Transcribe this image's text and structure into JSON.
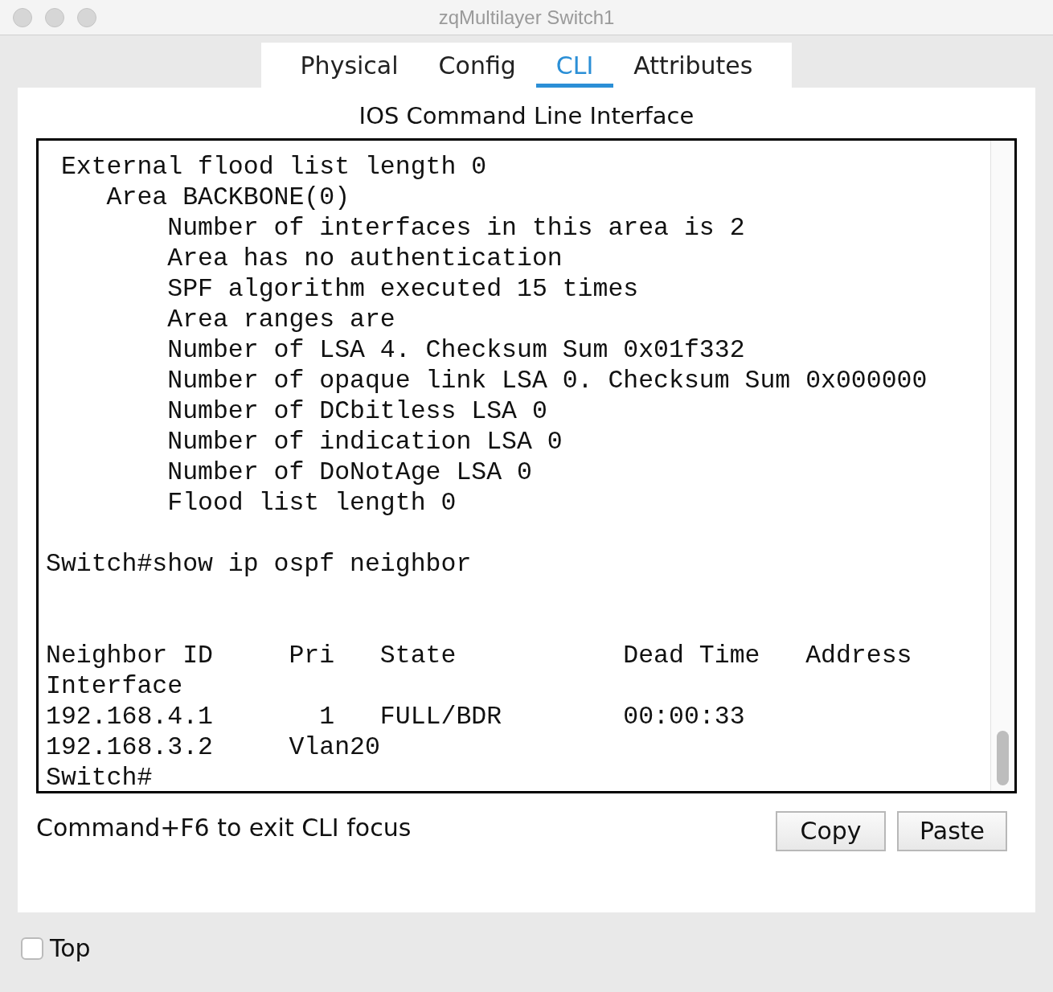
{
  "window": {
    "title": "zqMultilayer Switch1"
  },
  "tabs": [
    {
      "label": "Physical",
      "selected": false
    },
    {
      "label": "Config",
      "selected": false
    },
    {
      "label": "CLI",
      "selected": true
    },
    {
      "label": "Attributes",
      "selected": false
    }
  ],
  "cli": {
    "heading": "IOS Command Line Interface",
    "lines": [
      {
        "kind": "text",
        "text": " External flood list length 0"
      },
      {
        "kind": "text",
        "text": "    Area BACKBONE(0)"
      },
      {
        "kind": "text",
        "text": "        Number of interfaces in this area is 2"
      },
      {
        "kind": "text",
        "text": "        Area has no authentication"
      },
      {
        "kind": "text",
        "text": "        SPF algorithm executed 15 times"
      },
      {
        "kind": "text",
        "text": "        Area ranges are"
      },
      {
        "kind": "text",
        "text": "        Number of LSA 4. Checksum Sum 0x01f332"
      },
      {
        "kind": "text",
        "text": "        Number of opaque link LSA 0. Checksum Sum 0x000000"
      },
      {
        "kind": "text",
        "text": "        Number of DCbitless LSA 0"
      },
      {
        "kind": "text",
        "text": "        Number of indication LSA 0"
      },
      {
        "kind": "text",
        "text": "        Number of DoNotAge LSA 0"
      },
      {
        "kind": "text",
        "text": "        Flood list length 0"
      },
      {
        "kind": "blank"
      },
      {
        "kind": "text",
        "text": "Switch#show ip ospf neighbor"
      },
      {
        "kind": "blank"
      },
      {
        "kind": "blank"
      },
      {
        "kind": "text",
        "text": "Neighbor ID     Pri   State           Dead Time   Address"
      },
      {
        "kind": "text",
        "text": "Interface"
      },
      {
        "kind": "text",
        "text": "192.168.4.1       1   FULL/BDR        00:00:33"
      },
      {
        "kind": "text",
        "text": "192.168.3.2     Vlan20"
      },
      {
        "kind": "text",
        "text": "Switch#"
      }
    ],
    "hint": "Command+F6 to exit CLI focus",
    "buttons": [
      "Copy",
      "Paste"
    ]
  },
  "top_checkbox": {
    "label": "Top",
    "checked": false
  }
}
